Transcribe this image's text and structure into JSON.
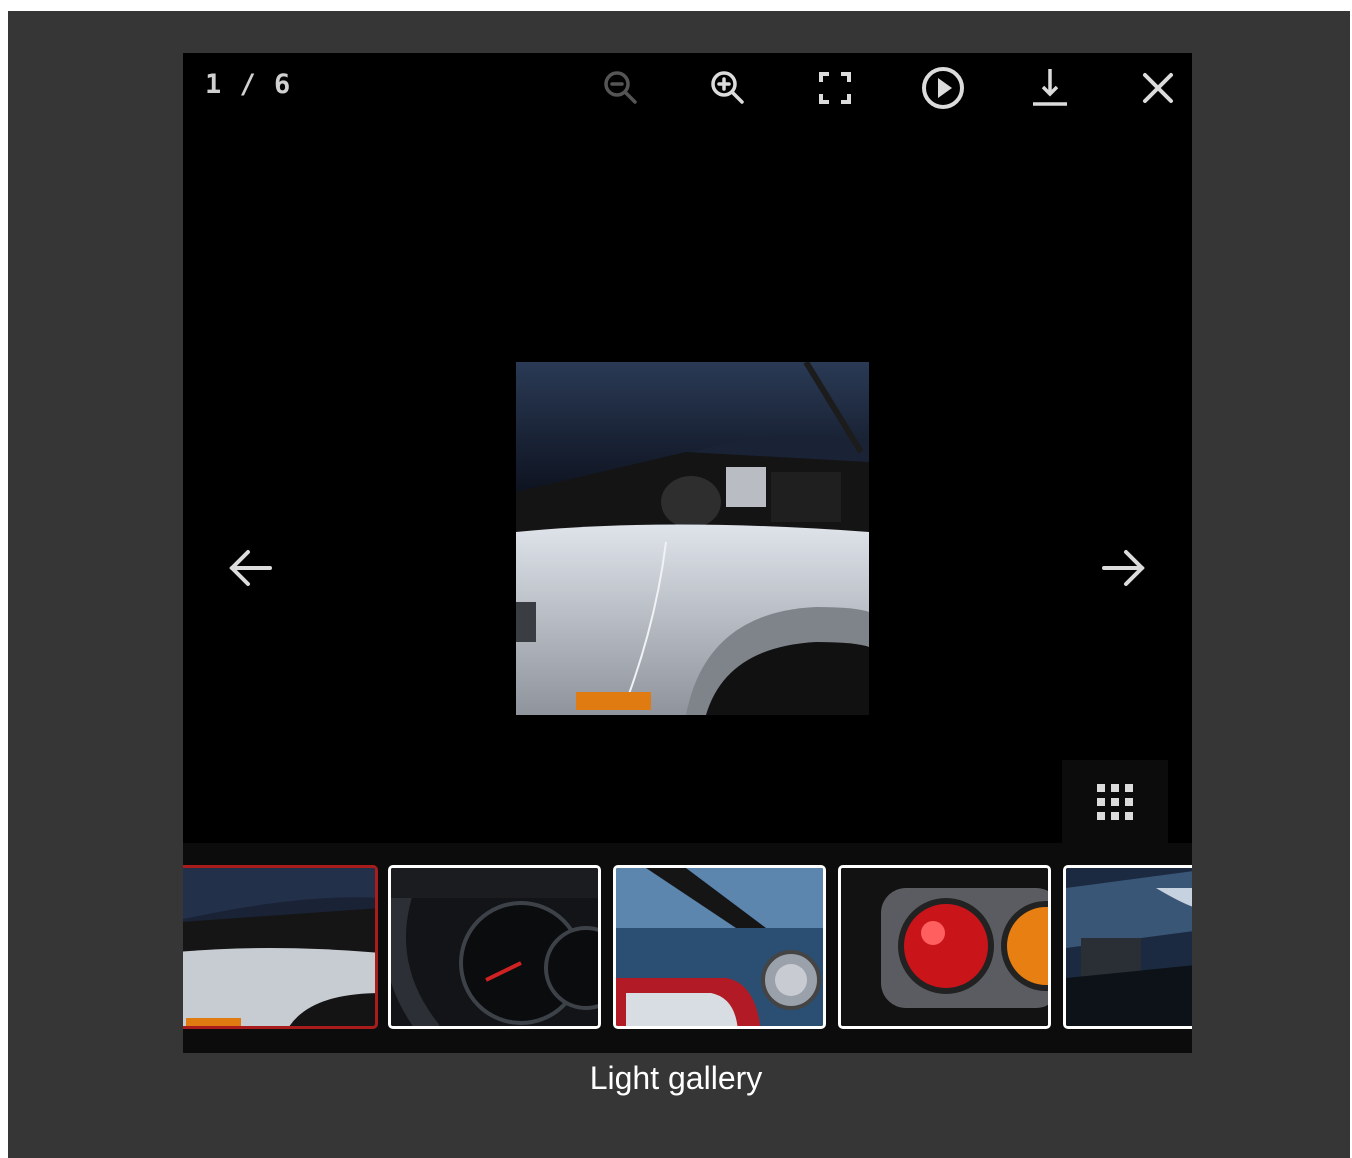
{
  "gallery": {
    "counter": "1 / 6",
    "toolbar": [
      "zoom-out-icon",
      "zoom-in-icon",
      "fullscreen-icon",
      "play-icon",
      "download-icon",
      "close-icon"
    ],
    "prev": "arrow-left-icon",
    "next": "arrow-right-icon",
    "grid_toggle": "grid-icon",
    "active_index": 0,
    "thumbnails": [
      "car-engine-bay",
      "speedometer",
      "side-mirror",
      "tail-lights",
      "rear-bumper"
    ],
    "colors": {
      "backdrop": "#363636",
      "viewer": "#000000",
      "active_border": "#a91c1c"
    }
  },
  "caption": "Light gallery"
}
